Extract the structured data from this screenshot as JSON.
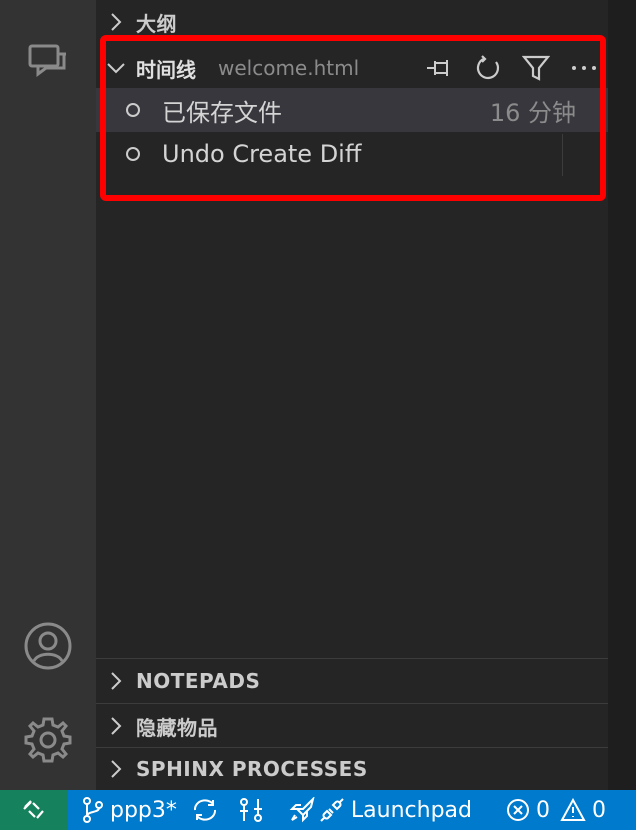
{
  "sidebar": {
    "outline_title": "大纲",
    "timeline": {
      "title": "时间线",
      "file": "welcome.html",
      "entries": [
        {
          "label": "已保存文件",
          "time": "16 分钟"
        },
        {
          "label": "Undo Create Diff",
          "time": ""
        }
      ]
    },
    "notepads_title": "NOTEPADS",
    "hidden_items_title": "隐藏物品",
    "sphinx_title": "SPHINX PROCESSES"
  },
  "status_bar": {
    "branch": "ppp3*",
    "launchpad": "Launchpad",
    "errors": "0",
    "warnings": "0"
  },
  "colors": {
    "activity_bar": "#333333",
    "sidebar": "#252526",
    "status_bar": "#007acc",
    "remote": "#16825d",
    "highlight": "#ff0000"
  }
}
